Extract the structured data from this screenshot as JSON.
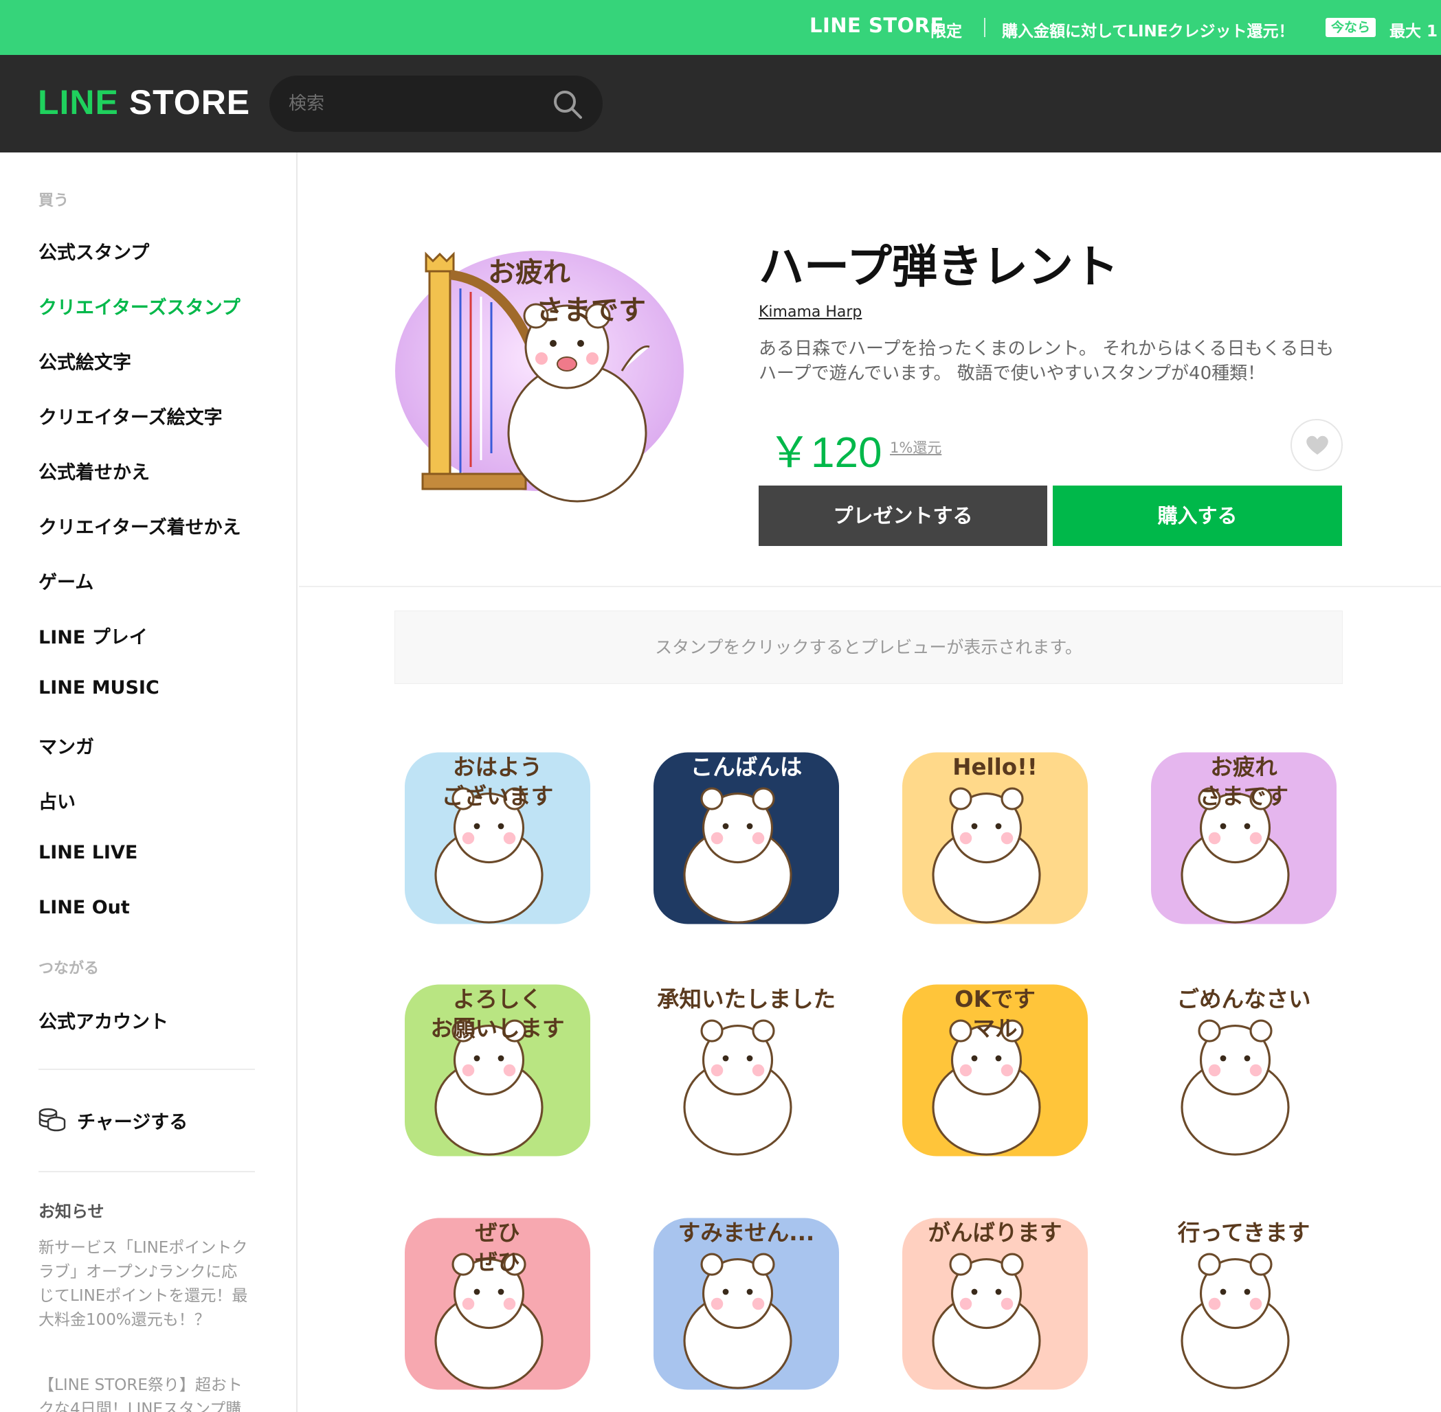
{
  "promo": {
    "brand": "LINE STORE",
    "limited": "限定",
    "message": "購入金額に対してLINEクレジット還元！",
    "badge": "今なら",
    "max": "最大 1"
  },
  "header": {
    "logo_line": "LINE",
    "logo_store": "STORE",
    "search_placeholder": "検索"
  },
  "sidebar": {
    "buy_heading": "買う",
    "items": [
      {
        "label": "公式スタンプ",
        "active": false
      },
      {
        "label": "クリエイターズスタンプ",
        "active": true
      },
      {
        "label": "公式絵文字",
        "active": false
      },
      {
        "label": "クリエイターズ絵文字",
        "active": false
      },
      {
        "label": "公式着せかえ",
        "active": false
      },
      {
        "label": "クリエイターズ着せかえ",
        "active": false
      },
      {
        "label": "ゲーム",
        "active": false
      },
      {
        "label": "LINE プレイ",
        "active": false
      },
      {
        "label": "LINE MUSIC",
        "active": false
      },
      {
        "label": "マンガ",
        "active": false
      },
      {
        "label": "占い",
        "active": false
      },
      {
        "label": "LINE LIVE",
        "active": false
      },
      {
        "label": "LINE Out",
        "active": false
      }
    ],
    "connect_heading": "つながる",
    "official_account": "公式アカウント",
    "charge": "チャージする",
    "notices_heading": "お知らせ",
    "notices": [
      "新サービス「LINEポイントクラブ」オープン♪ランクに応じてLINEポイントを還元！最大料金100%還元も！？",
      "【LINE STORE祭り】超おトクな4日間！LINEスタンプ購"
    ]
  },
  "product": {
    "title": "ハープ弾きレント",
    "author": "Kimama Harp",
    "description": "ある日森でハープを拾ったくまのレント。 それからはくる日もくる日もハープで遊んでいます。 敬語で使いやすいスタンプが40種類！",
    "price": "￥120",
    "points": "1%還元",
    "present_button": "プレゼントする",
    "buy_button": "購入する",
    "preview_hint": "スタンプをクリックするとプレビューが表示されます。",
    "main_sticker_text": [
      "お疲れ",
      "さまです"
    ]
  },
  "stickers": [
    {
      "name": "sticker-ohayou",
      "text": [
        "おはよう",
        "ございます"
      ],
      "bg": "#bfe3f5"
    },
    {
      "name": "sticker-konbanwa",
      "text": [
        "こんばんは"
      ],
      "bg": "#1f3a63"
    },
    {
      "name": "sticker-hello",
      "text": [
        "Hello!!"
      ],
      "bg": "#ffd98a"
    },
    {
      "name": "sticker-otsukare",
      "text": [
        "お疲れ",
        "さまです"
      ],
      "bg": "#e5b6ee"
    },
    {
      "name": "sticker-yoroshiku",
      "text": [
        "よろしく",
        "お願いします"
      ],
      "bg": "#b9e582"
    },
    {
      "name": "sticker-shouchi",
      "text": [
        "承知いたしました"
      ],
      "bg": "#ffffff"
    },
    {
      "name": "sticker-ok",
      "text": [
        "OKです",
        "マル"
      ],
      "bg": "#ffc53a"
    },
    {
      "name": "sticker-gomennasai",
      "text": [
        "ごめんなさい"
      ],
      "bg": "#ffffff"
    },
    {
      "name": "sticker-zehi",
      "text": [
        "ぜひ",
        "ぜひ"
      ],
      "bg": "#f7a8b0"
    },
    {
      "name": "sticker-sumimasen",
      "text": [
        "すみません..."
      ],
      "bg": "#a8c4ee"
    },
    {
      "name": "sticker-ganbarimasu",
      "text": [
        "がんばります"
      ],
      "bg": "#ffd0c0"
    },
    {
      "name": "sticker-ittekimasu",
      "text": [
        "行ってきます"
      ],
      "bg": "#ffffff"
    }
  ],
  "colors": {
    "brand_green": "#00b84a",
    "promo_green": "#36d47a",
    "header_dark": "#2b2b2b"
  }
}
